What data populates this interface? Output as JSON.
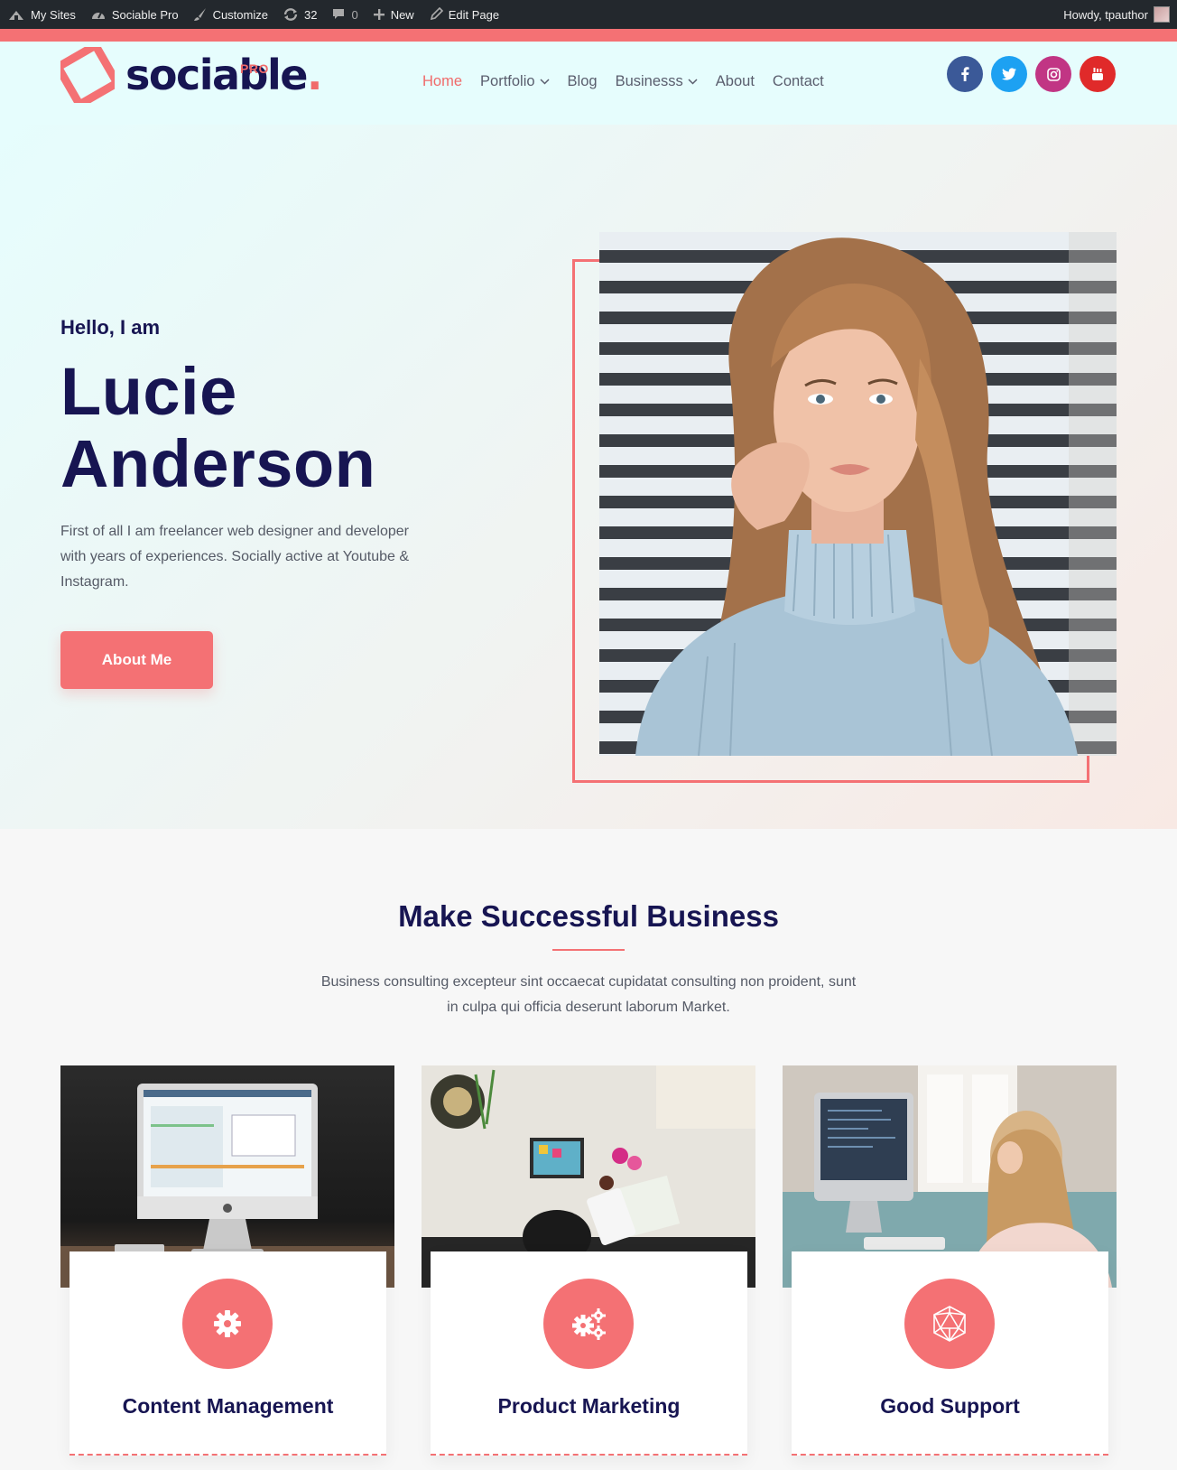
{
  "adminbar": {
    "my_sites": "My Sites",
    "site_name": "Sociable Pro",
    "customize": "Customize",
    "updates": "32",
    "comments": "0",
    "new": "New",
    "edit_page": "Edit Page",
    "howdy": "Howdy, tpauthor"
  },
  "header": {
    "logo_text": "sociable",
    "logo_dot": ".",
    "logo_badge": "PRO",
    "nav": [
      {
        "label": "Home"
      },
      {
        "label": "Portfolio"
      },
      {
        "label": "Blog"
      },
      {
        "label": "Businesss"
      },
      {
        "label": "About"
      },
      {
        "label": "Contact"
      }
    ],
    "socials": [
      "facebook-icon",
      "twitter-icon",
      "instagram-icon",
      "youtube-icon"
    ]
  },
  "hero": {
    "kicker": "Hello, I am",
    "name_line1": "Lucie",
    "name_line2": "Anderson",
    "description": "First of all I am freelancer web designer and developer with years of experiences. Socially active at Youtube & Instagram.",
    "button_label": "About Me"
  },
  "business": {
    "title": "Make Successful Business",
    "description_line1": "Business consulting excepteur sint occaecat cupidatat consulting non proident, sunt",
    "description_line2": "in culpa qui officia deserunt laborum Market.",
    "cards": [
      {
        "title": "Content Management",
        "icon": "gear-icon"
      },
      {
        "title": "Product Marketing",
        "icon": "gears-icon"
      },
      {
        "title": "Good Support",
        "icon": "geodesic-icon"
      }
    ]
  },
  "colors": {
    "accent": "#f47174",
    "heading": "#171552",
    "facebook": "#3b5998",
    "twitter": "#1da1f2",
    "instagram": "#c13584",
    "youtube": "#e02a2a",
    "adminbar": "#23282d"
  }
}
